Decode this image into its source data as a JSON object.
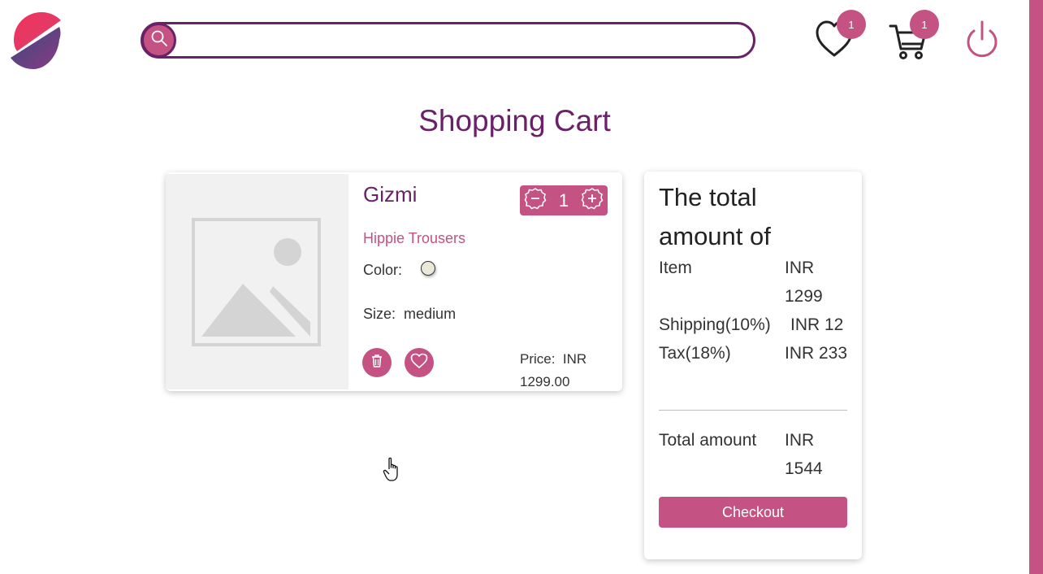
{
  "header": {
    "search": {
      "placeholder": "",
      "value": ""
    },
    "wishlist_count": "1",
    "cart_count": "1"
  },
  "page": {
    "title": "Shopping Cart"
  },
  "cart_item": {
    "name": "Gizmi",
    "quantity": "1",
    "subtitle": "Hippie Trousers",
    "color_label": "Color:",
    "color_value": "#ebe8d7",
    "size_label": "Size:",
    "size_value": "medium",
    "price_label": "Price:",
    "price_value": "INR 1299.00"
  },
  "summary": {
    "title": "The total amount of",
    "rows": [
      {
        "label": "Item",
        "value": "INR 1299"
      },
      {
        "label": "Shipping(10%)",
        "value": "INR 12"
      },
      {
        "label": "Tax(18%)",
        "value": "INR 233"
      }
    ],
    "total_label": "Total amount",
    "total_value": "INR 1544",
    "checkout_label": "Checkout"
  },
  "colors": {
    "accent": "#c45282",
    "brand": "#6a2168"
  }
}
